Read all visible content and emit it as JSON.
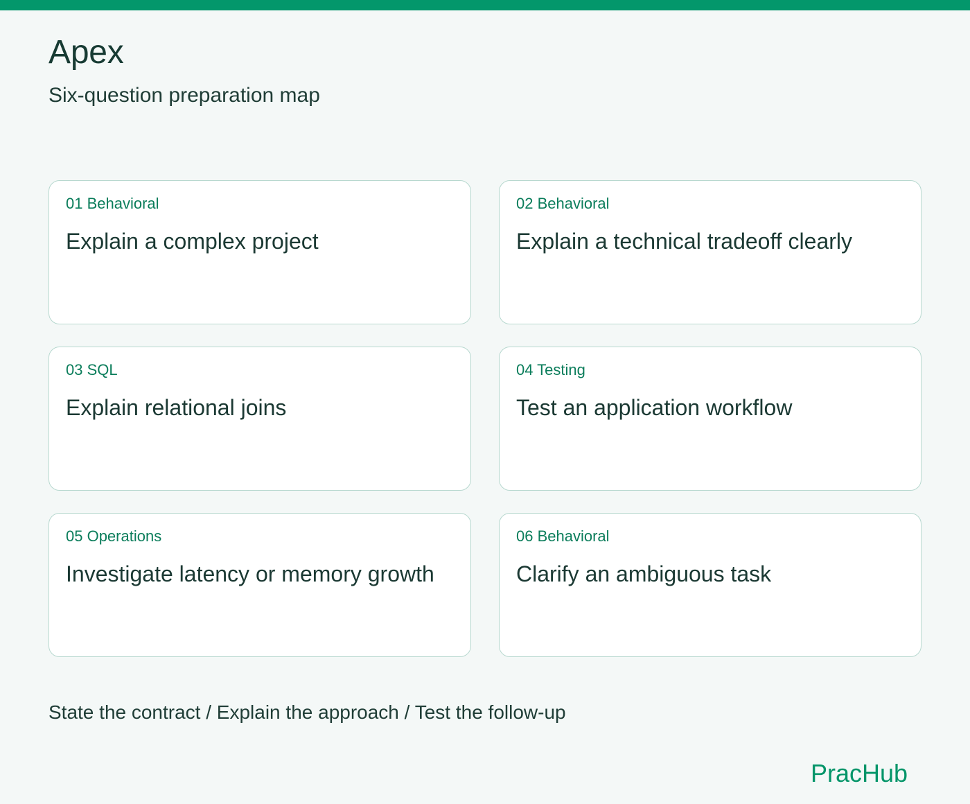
{
  "header": {
    "title": "Apex",
    "subtitle": "Six-question preparation map"
  },
  "cards": [
    {
      "label": "01 Behavioral",
      "question": "Explain a complex project"
    },
    {
      "label": "02 Behavioral",
      "question": "Explain a technical tradeoff clearly"
    },
    {
      "label": "03 SQL",
      "question": "Explain relational joins"
    },
    {
      "label": "04 Testing",
      "question": "Test an application workflow"
    },
    {
      "label": "05 Operations",
      "question": "Investigate latency or memory growth"
    },
    {
      "label": "06 Behavioral",
      "question": "Clarify an ambiguous task"
    }
  ],
  "footer": {
    "note": "State the contract / Explain the approach / Test the follow-up",
    "brand": "PracHub"
  },
  "colors": {
    "accent": "#03976b",
    "background": "#f4f8f7",
    "card_border": "#b7d8cf",
    "label_text": "#0b7d5b",
    "body_text": "#1b3933"
  }
}
